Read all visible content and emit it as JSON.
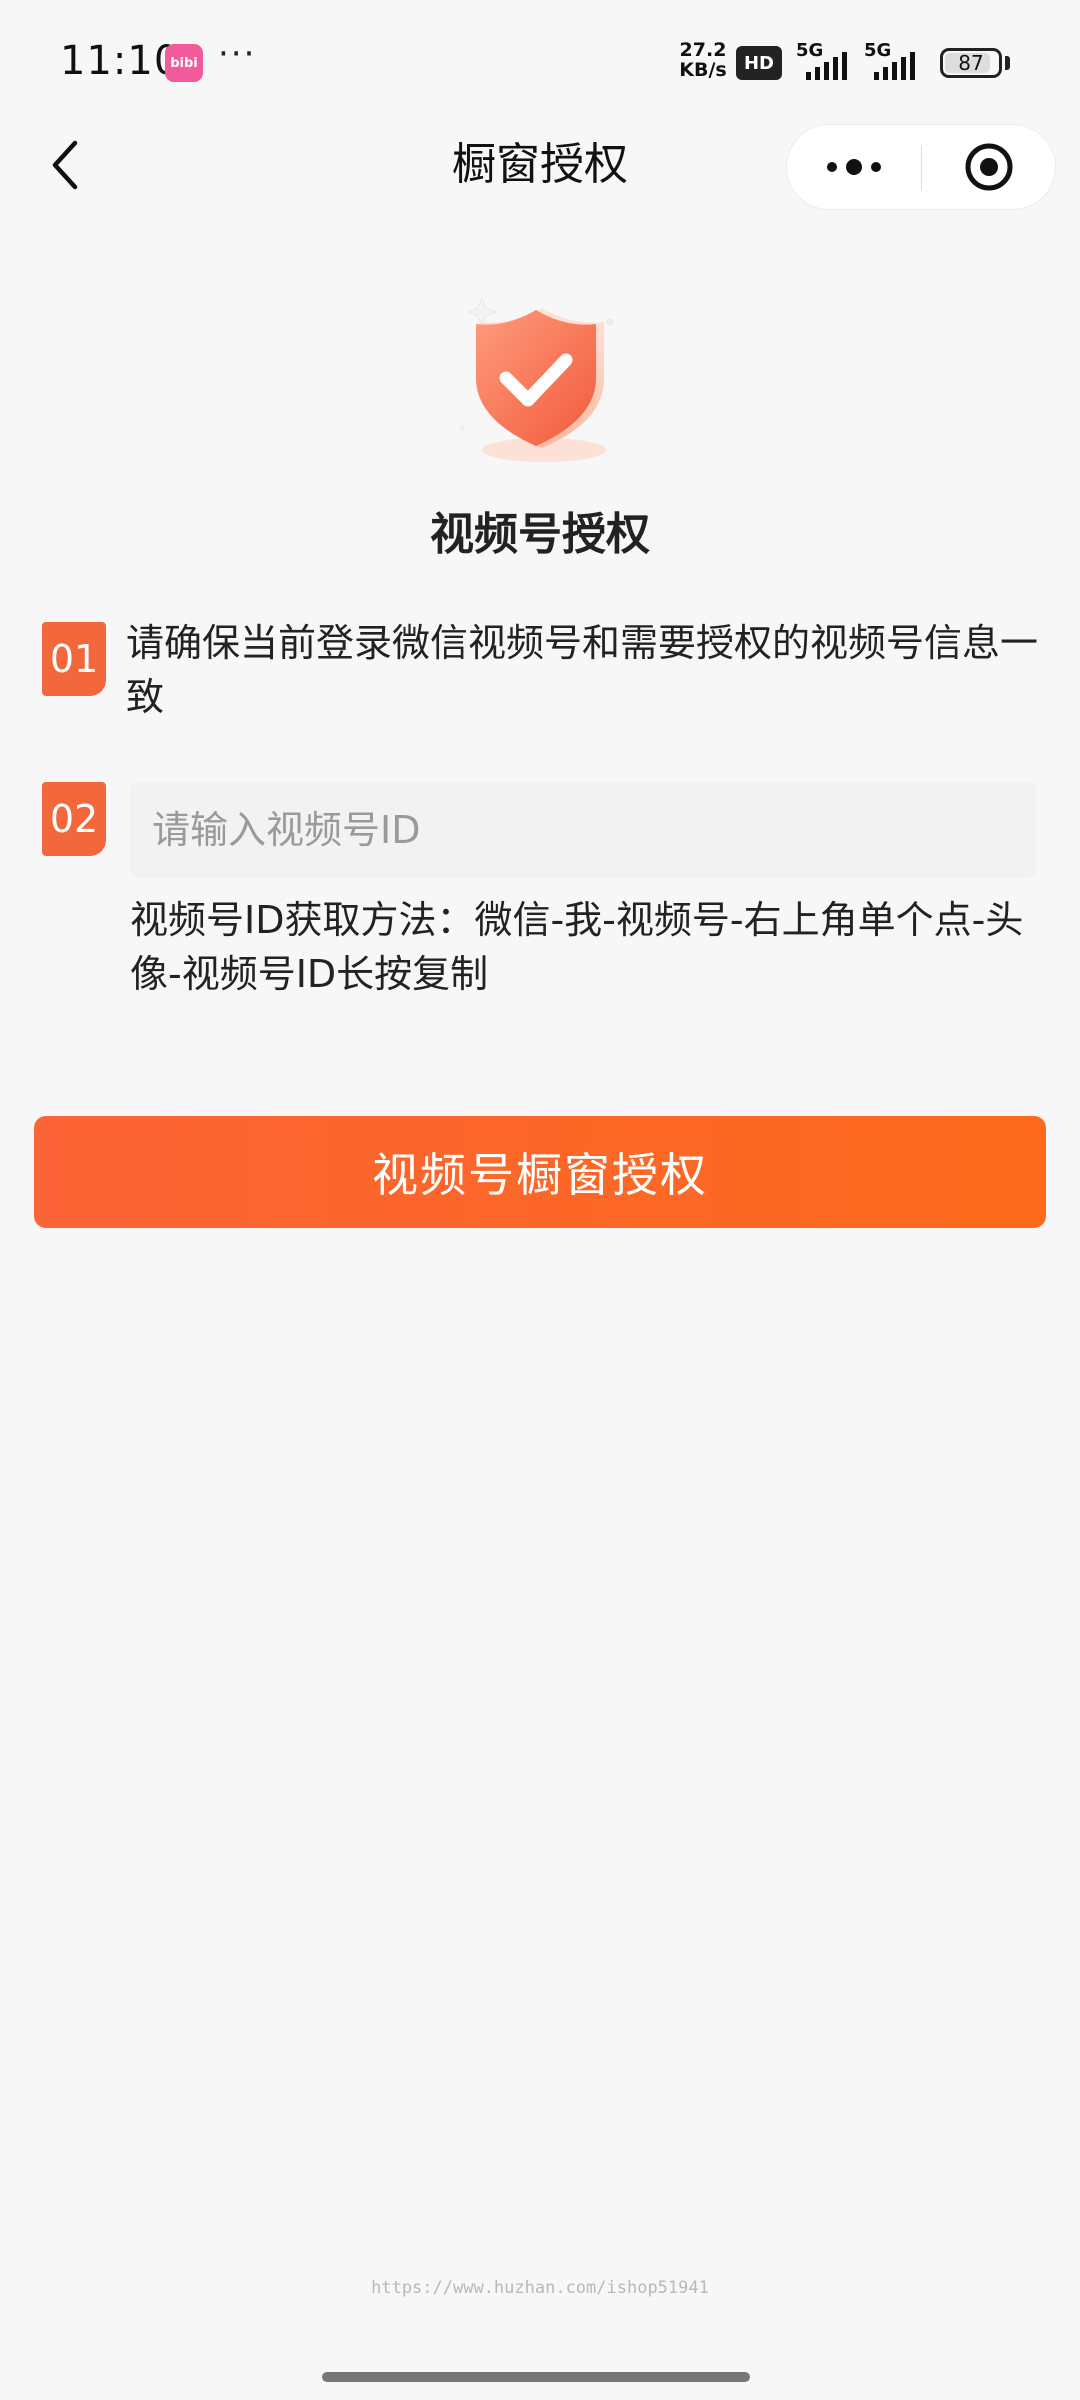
{
  "status_bar": {
    "time": "11:10",
    "app_badge_text": "bibi",
    "more": "···",
    "net_speed_value": "27.2",
    "net_speed_unit": "KB/s",
    "hd_label": "HD",
    "signal1_label": "5G",
    "signal2_label": "5G",
    "battery_level": "87"
  },
  "nav": {
    "title": "橱窗授权",
    "back_icon": "chevron-left-icon",
    "menu_icon": "more-dots-icon",
    "close_icon": "target-circle-icon"
  },
  "hero": {
    "icon": "shield-check-icon",
    "title": "视频号授权"
  },
  "steps": {
    "step1_number": "01",
    "step1_text": "请确保当前登录微信视频号和需要授权的视频号信息一致",
    "step2_number": "02",
    "id_input_placeholder": "请输入视频号ID",
    "id_input_value": "",
    "hint": "视频号ID获取方法：微信-我-视频号-右上角单个点-头像-视频号ID长按复制"
  },
  "actions": {
    "auth_button_label": "视频号橱窗授权"
  },
  "footer": {
    "watermark": "https://www.huzhan.com/ishop51941"
  },
  "colors": {
    "accent": "#f2673b",
    "button_start": "#fb6436",
    "button_end": "#fd6a1c",
    "background": "#f7f7f7"
  }
}
